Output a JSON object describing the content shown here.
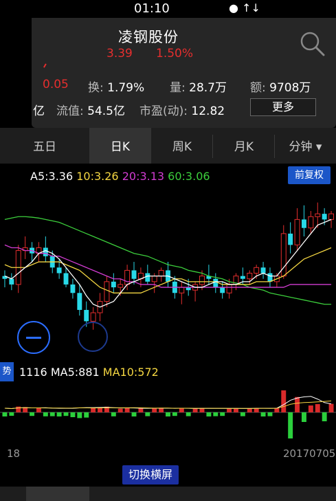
{
  "status": {
    "time": "01:10",
    "icons": "● ↑↓"
  },
  "header": {
    "stock_name": "凌钢股份",
    "price": "3.39",
    "change_pct": "1.50%",
    "change_amount": "0.05",
    "turnover_label": "换:",
    "turnover_value": "1.79%",
    "volume_label": "量:",
    "volume_value": "28.7万",
    "amount_label": "额:",
    "amount_value": "9708万",
    "cap_suffix": "亿",
    "float_cap_label": "流值:",
    "float_cap_value": "54.5亿",
    "pe_label": "市盈(动):",
    "pe_value": "12.82",
    "more_button": "更多"
  },
  "tabs": [
    {
      "label": "五日",
      "active": false
    },
    {
      "label": "日K",
      "active": true
    },
    {
      "label": "周K",
      "active": false
    },
    {
      "label": "月K",
      "active": false
    },
    {
      "label": "分钟 ▾",
      "active": false
    }
  ],
  "ma_legend": {
    "ma5": "A5:3.36",
    "ma10": "10:3.26",
    "ma20": "20:3.13",
    "ma60": "60:3.06"
  },
  "adjust_button": "前复权",
  "volume_legend": {
    "tag": "势",
    "vol": "1116",
    "ma5": "MA5:881",
    "ma10": "MA10:572"
  },
  "dates": {
    "left": "18",
    "right": "20170705"
  },
  "switch_button": "切换横屏",
  "colors": {
    "up": "#e52e2e",
    "down": "#28d9e8",
    "ma5": "#ffffff",
    "ma10": "#f5d742",
    "ma20": "#d23cd2",
    "ma60": "#3ccf3c",
    "accent": "#1b56c8"
  },
  "chart_data": {
    "type": "candlestick",
    "price_range": [
      2.86,
      3.48
    ],
    "candles": [
      [
        3.16,
        3.18,
        3.12,
        3.15
      ],
      [
        3.15,
        3.17,
        3.11,
        3.13
      ],
      [
        3.13,
        3.27,
        3.1,
        3.25
      ],
      [
        3.25,
        3.3,
        3.22,
        3.26
      ],
      [
        3.26,
        3.28,
        3.21,
        3.24
      ],
      [
        3.24,
        3.28,
        3.21,
        3.26
      ],
      [
        3.26,
        3.3,
        3.21,
        3.23
      ],
      [
        3.23,
        3.25,
        3.17,
        3.19
      ],
      [
        3.19,
        3.22,
        3.15,
        3.17
      ],
      [
        3.17,
        3.19,
        3.12,
        3.13
      ],
      [
        3.13,
        3.15,
        3.08,
        3.1
      ],
      [
        3.1,
        3.13,
        3.02,
        3.04
      ],
      [
        3.04,
        3.07,
        2.98,
        3.0
      ],
      [
        3.0,
        3.05,
        2.97,
        3.03
      ],
      [
        3.03,
        3.1,
        3.0,
        3.07
      ],
      [
        3.07,
        3.16,
        3.05,
        3.14
      ],
      [
        3.14,
        3.17,
        3.1,
        3.12
      ],
      [
        3.12,
        3.15,
        3.09,
        3.13
      ],
      [
        3.13,
        3.2,
        3.11,
        3.18
      ],
      [
        3.18,
        3.21,
        3.13,
        3.15
      ],
      [
        3.15,
        3.19,
        3.12,
        3.17
      ],
      [
        3.17,
        3.2,
        3.13,
        3.14
      ],
      [
        3.14,
        3.17,
        3.1,
        3.16
      ],
      [
        3.16,
        3.19,
        3.14,
        3.18
      ],
      [
        3.18,
        3.21,
        3.12,
        3.14
      ],
      [
        3.14,
        3.16,
        3.08,
        3.1
      ],
      [
        3.1,
        3.14,
        3.06,
        3.12
      ],
      [
        3.12,
        3.15,
        3.09,
        3.11
      ],
      [
        3.11,
        3.14,
        3.07,
        3.13
      ],
      [
        3.13,
        3.18,
        3.11,
        3.16
      ],
      [
        3.16,
        3.2,
        3.13,
        3.15
      ],
      [
        3.15,
        3.17,
        3.1,
        3.12
      ],
      [
        3.12,
        3.14,
        3.08,
        3.1
      ],
      [
        3.1,
        3.15,
        3.08,
        3.13
      ],
      [
        3.13,
        3.17,
        3.11,
        3.16
      ],
      [
        3.16,
        3.19,
        3.13,
        3.15
      ],
      [
        3.15,
        3.18,
        3.13,
        3.17
      ],
      [
        3.17,
        3.2,
        3.15,
        3.19
      ],
      [
        3.19,
        3.21,
        3.15,
        3.17
      ],
      [
        3.17,
        3.19,
        3.12,
        3.14
      ],
      [
        3.14,
        3.17,
        3.12,
        3.16
      ],
      [
        3.16,
        3.34,
        3.15,
        3.31
      ],
      [
        3.31,
        3.35,
        3.24,
        3.27
      ],
      [
        3.27,
        3.4,
        3.25,
        3.36
      ],
      [
        3.36,
        3.41,
        3.3,
        3.33
      ],
      [
        3.33,
        3.39,
        3.31,
        3.37
      ],
      [
        3.37,
        3.42,
        3.33,
        3.38
      ],
      [
        3.38,
        3.4,
        3.34,
        3.36
      ],
      [
        3.36,
        3.39,
        3.33,
        3.38
      ]
    ],
    "ma5": [
      3.16,
      3.15,
      3.17,
      3.19,
      3.21,
      3.24,
      3.25,
      3.24,
      3.22,
      3.19,
      3.16,
      3.13,
      3.09,
      3.06,
      3.05,
      3.06,
      3.07,
      3.1,
      3.13,
      3.14,
      3.15,
      3.16,
      3.16,
      3.16,
      3.16,
      3.15,
      3.14,
      3.13,
      3.12,
      3.12,
      3.13,
      3.14,
      3.14,
      3.13,
      3.13,
      3.14,
      3.14,
      3.16,
      3.17,
      3.16,
      3.16,
      3.19,
      3.22,
      3.25,
      3.28,
      3.31,
      3.34,
      3.35,
      3.36
    ],
    "ma10": [
      3.2,
      3.19,
      3.19,
      3.19,
      3.2,
      3.21,
      3.21,
      3.21,
      3.21,
      3.2,
      3.19,
      3.18,
      3.16,
      3.14,
      3.12,
      3.11,
      3.1,
      3.1,
      3.1,
      3.1,
      3.1,
      3.11,
      3.12,
      3.13,
      3.14,
      3.15,
      3.15,
      3.14,
      3.14,
      3.14,
      3.14,
      3.14,
      3.13,
      3.13,
      3.13,
      3.13,
      3.13,
      3.14,
      3.14,
      3.14,
      3.15,
      3.16,
      3.18,
      3.2,
      3.22,
      3.23,
      3.24,
      3.25,
      3.26
    ],
    "ma20": [
      3.27,
      3.26,
      3.26,
      3.25,
      3.25,
      3.24,
      3.24,
      3.23,
      3.23,
      3.22,
      3.21,
      3.2,
      3.19,
      3.18,
      3.17,
      3.16,
      3.15,
      3.15,
      3.14,
      3.14,
      3.13,
      3.13,
      3.13,
      3.12,
      3.12,
      3.12,
      3.12,
      3.12,
      3.12,
      3.12,
      3.12,
      3.12,
      3.12,
      3.12,
      3.12,
      3.12,
      3.12,
      3.12,
      3.12,
      3.12,
      3.12,
      3.12,
      3.13,
      3.13,
      3.13,
      3.13,
      3.13,
      3.13,
      3.13
    ],
    "ma60": [
      3.36,
      3.365,
      3.37,
      3.37,
      3.368,
      3.365,
      3.36,
      3.355,
      3.35,
      3.34,
      3.33,
      3.32,
      3.31,
      3.3,
      3.29,
      3.28,
      3.27,
      3.26,
      3.25,
      3.24,
      3.235,
      3.23,
      3.22,
      3.21,
      3.2,
      3.195,
      3.19,
      3.18,
      3.175,
      3.17,
      3.16,
      3.155,
      3.15,
      3.14,
      3.135,
      3.13,
      3.12,
      3.115,
      3.11,
      3.1,
      3.095,
      3.09,
      3.085,
      3.08,
      3.075,
      3.07,
      3.065,
      3.06,
      3.06
    ],
    "volume": [
      300,
      250,
      420,
      380,
      260,
      330,
      290,
      280,
      300,
      260,
      350,
      420,
      380,
      300,
      320,
      410,
      290,
      270,
      320,
      300,
      310,
      280,
      290,
      330,
      300,
      260,
      310,
      280,
      270,
      320,
      300,
      280,
      260,
      290,
      300,
      280,
      290,
      310,
      300,
      280,
      320,
      1600,
      1900,
      1116,
      700,
      500,
      600,
      650,
      620
    ],
    "volume_max": 2000
  }
}
